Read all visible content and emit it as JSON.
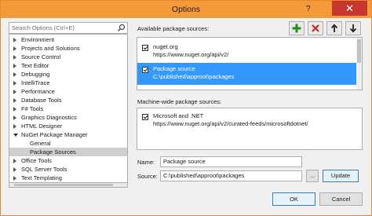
{
  "window": {
    "title": "Options",
    "help_label": "?",
    "close_label": "✕"
  },
  "search": {
    "placeholder": "Search Options (Ctrl+E)"
  },
  "tree": {
    "items": [
      {
        "label": "Environment",
        "expanded": false,
        "child": false
      },
      {
        "label": "Projects and Solutions",
        "expanded": false,
        "child": false
      },
      {
        "label": "Source Control",
        "expanded": false,
        "child": false
      },
      {
        "label": "Text Editor",
        "expanded": false,
        "child": false
      },
      {
        "label": "Debugging",
        "expanded": false,
        "child": false
      },
      {
        "label": "IntelliTrace",
        "expanded": false,
        "child": false
      },
      {
        "label": "Performance",
        "expanded": false,
        "child": false
      },
      {
        "label": "Database Tools",
        "expanded": false,
        "child": false
      },
      {
        "label": "F# Tools",
        "expanded": false,
        "child": false
      },
      {
        "label": "Graphics Diagnostics",
        "expanded": false,
        "child": false
      },
      {
        "label": "HTML Designer",
        "expanded": false,
        "child": false
      },
      {
        "label": "NuGet Package Manager",
        "expanded": true,
        "child": false
      },
      {
        "label": "General",
        "expanded": false,
        "child": true
      },
      {
        "label": "Package Sources",
        "expanded": false,
        "child": true,
        "selected": true
      },
      {
        "label": "Office Tools",
        "expanded": false,
        "child": false
      },
      {
        "label": "SQL Server Tools",
        "expanded": false,
        "child": false
      },
      {
        "label": "Text Templating",
        "expanded": false,
        "child": false
      }
    ]
  },
  "available": {
    "heading": "Available package sources:",
    "sources": [
      {
        "name": "nuget.org",
        "url": "https://www.nuget.org/api/v2/",
        "checked": true,
        "selected": false
      },
      {
        "name": "Package source",
        "url": "C:\\published\\approot\\packages",
        "checked": true,
        "selected": true
      }
    ]
  },
  "toolbar": {
    "add_icon": "plus-icon",
    "remove_icon": "x-icon",
    "up_icon": "arrow-up-icon",
    "down_icon": "arrow-down-icon"
  },
  "machine": {
    "heading": "Machine-wide package sources:",
    "sources": [
      {
        "name": "Microsoft and .NET",
        "url": "https://www.nuget.org/api/v2/curated-feeds/microsoftdotnet/",
        "checked": true
      }
    ]
  },
  "form": {
    "name_label": "Name:",
    "name_value": "Package source",
    "source_label": "Source:",
    "source_value": "C:\\published\\approot\\packages",
    "browse_label": "...",
    "update_label": "Update"
  },
  "footer": {
    "ok_label": "OK",
    "cancel_label": "Cancel"
  },
  "colors": {
    "titlebar": "#f39a3b",
    "close": "#c7372f",
    "selection": "#3399ff",
    "add_green": "#1e8f1e",
    "remove_red": "#c62828"
  }
}
